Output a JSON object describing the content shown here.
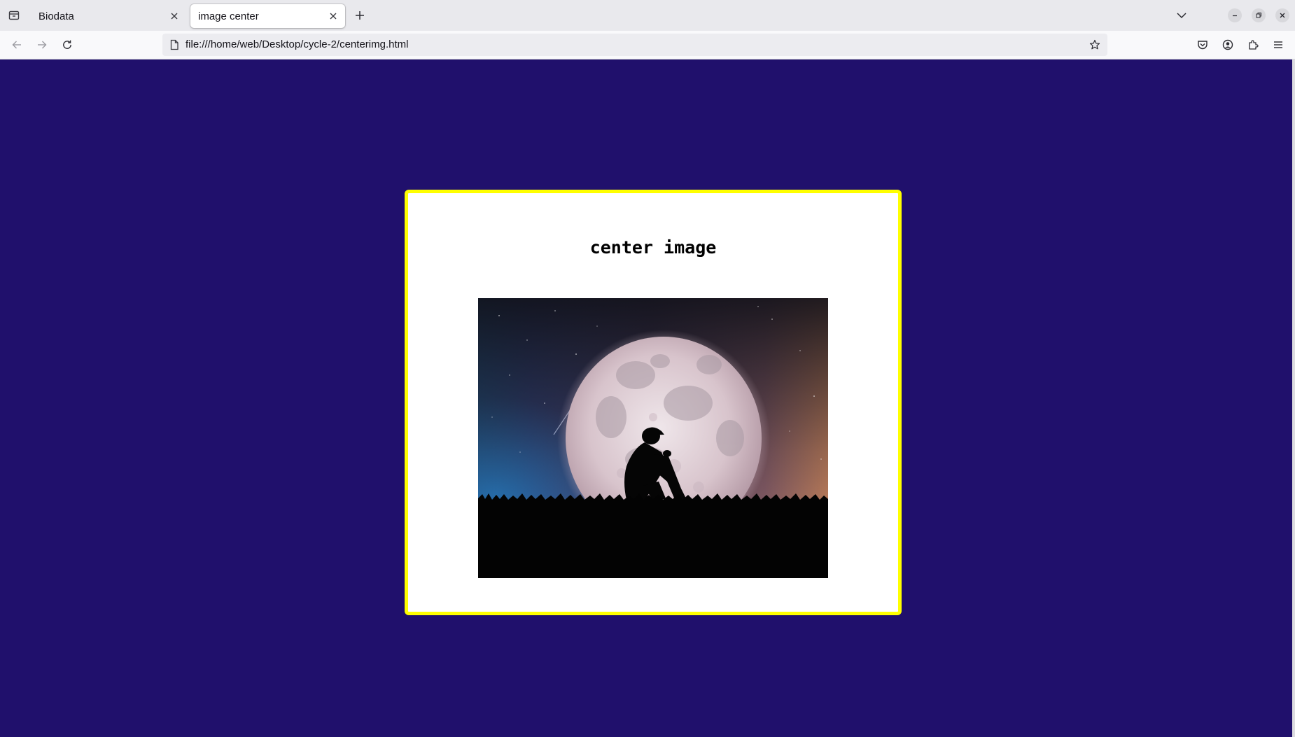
{
  "browser": {
    "tabs": [
      {
        "label": "Biodata",
        "active": false
      },
      {
        "label": "image center",
        "active": true
      }
    ],
    "url": "file:///home/web/Desktop/cycle-2/centerimg.html"
  },
  "page": {
    "heading": "center image",
    "image_description_icon": "moon-silhouette-photo",
    "background_color": "#20106c",
    "box_border_color": "#ffff00"
  }
}
